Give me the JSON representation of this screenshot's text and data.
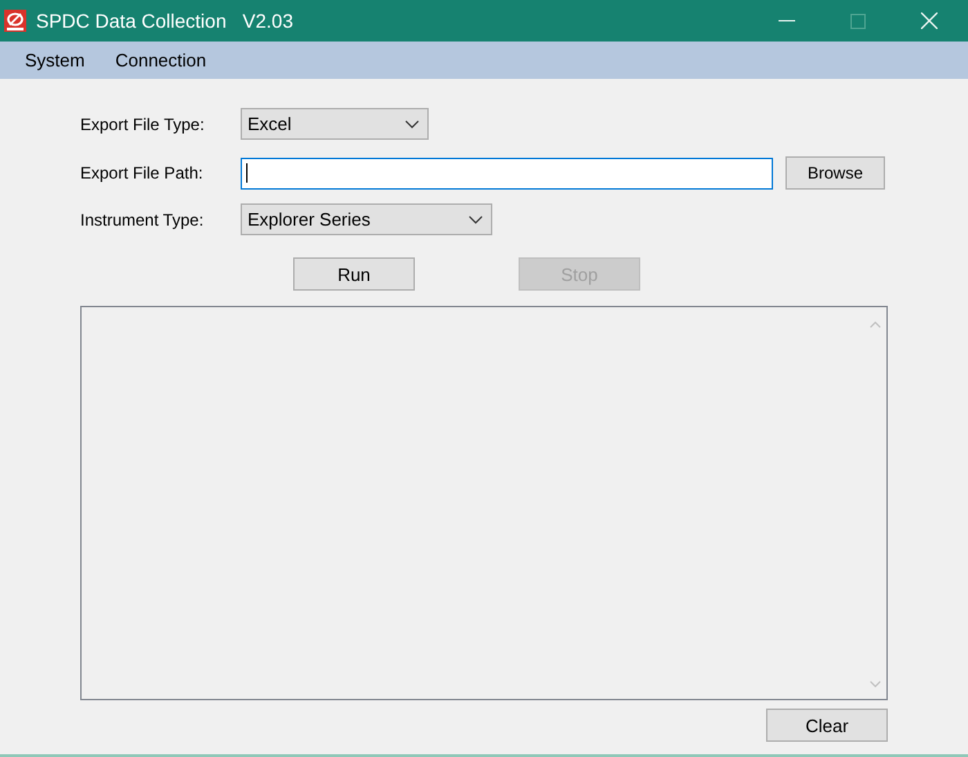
{
  "window": {
    "title": "SPDC Data Collection   V2.03"
  },
  "menu": [
    "System",
    "Connection"
  ],
  "form": {
    "export_file_type": {
      "label": "Export File Type:",
      "value": "Excel"
    },
    "export_file_path": {
      "label": "Export File Path:",
      "focused": true,
      "browse": "Browse"
    },
    "instrument_type": {
      "label": "Instrument Type:",
      "value": "Explorer Series"
    }
  },
  "actions": [
    {
      "label": "Run",
      "disabled": false
    },
    {
      "label": "Stop",
      "disabled": true
    }
  ],
  "clear": "Clear"
}
